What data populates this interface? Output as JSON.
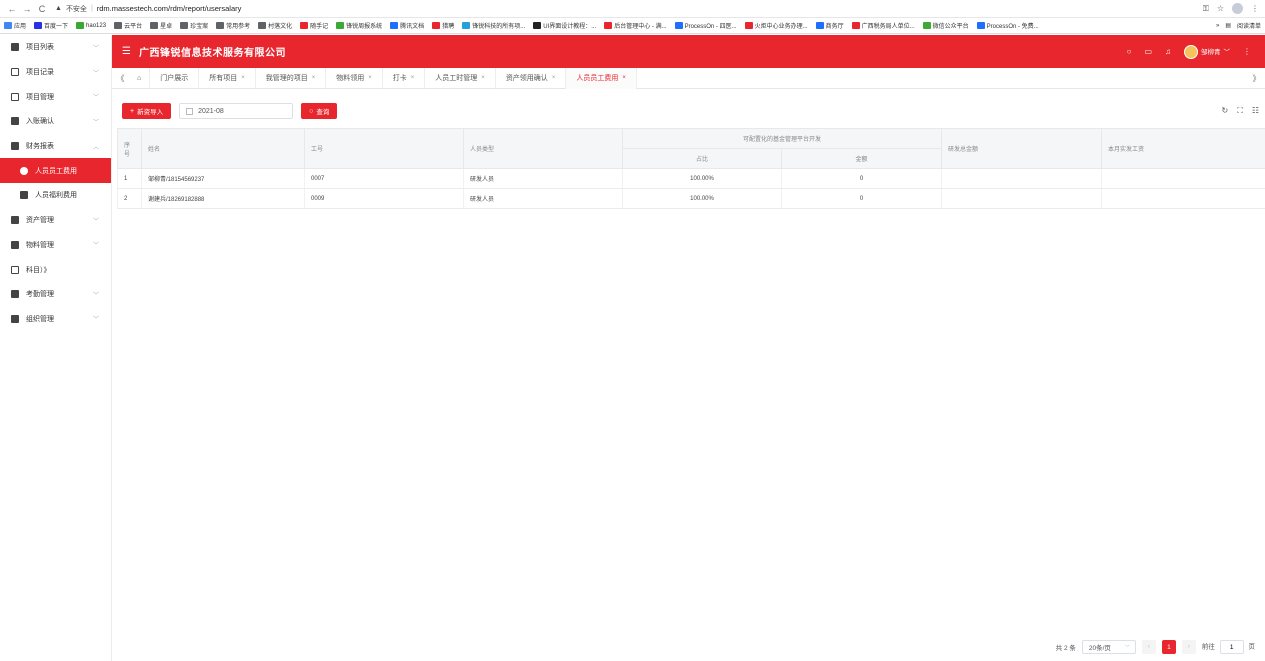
{
  "browser": {
    "insecure_label": "不安全",
    "url": "rdm.massestech.com/rdm/report/usersalary",
    "bookmarks": [
      {
        "label": "应用",
        "color": "#4285f4"
      },
      {
        "label": "百度一下",
        "color": "#2932e1"
      },
      {
        "label": "hao123",
        "color": "#38a832"
      },
      {
        "label": "云平台",
        "color": "#5f6368"
      },
      {
        "label": "星卓",
        "color": "#5f6368"
      },
      {
        "label": "珍宝案",
        "color": "#5f6368"
      },
      {
        "label": "常用参考",
        "color": "#5f6368"
      },
      {
        "label": "村落文化",
        "color": "#5f6368"
      },
      {
        "label": "随手记",
        "color": "#e8262e"
      },
      {
        "label": "锋锐周报系统",
        "color": "#3aaa35"
      },
      {
        "label": "腾讯文档",
        "color": "#1e6fff"
      },
      {
        "label": "猎聘",
        "color": "#e8262e"
      },
      {
        "label": "锋锐科技的所有项...",
        "color": "#26a0da"
      },
      {
        "label": "UI界面设计教程：...",
        "color": "#222222"
      },
      {
        "label": "后台管理中心 - 满...",
        "color": "#e8262e"
      },
      {
        "label": "ProcessOn - 四医...",
        "color": "#1e6fff"
      },
      {
        "label": "火炬中心业务办理...",
        "color": "#e8262e"
      },
      {
        "label": "商务厅",
        "color": "#1e6fff"
      },
      {
        "label": "广西税务局人单位...",
        "color": "#e8262e"
      },
      {
        "label": "微信公众平台",
        "color": "#3aaa35"
      },
      {
        "label": "ProcessOn - 免费...",
        "color": "#1e6fff"
      }
    ],
    "bookmarks_more": "»",
    "reading_list": "阅读清单"
  },
  "sidebar": {
    "items": [
      {
        "label": "项目列表",
        "chevron": "﹀",
        "icon": "folder-icon"
      },
      {
        "label": "项目记录",
        "chevron": "﹀",
        "icon": "list-icon"
      },
      {
        "label": "项目管理",
        "chevron": "﹀",
        "icon": "window-icon"
      },
      {
        "label": "入账确认",
        "chevron": "﹀",
        "icon": "user-icon"
      },
      {
        "label": "财务报表",
        "chevron": "︿",
        "icon": "report-icon"
      },
      {
        "label": "人员员工费用",
        "chevron": "",
        "icon": "person-icon",
        "active": true
      },
      {
        "label": "人员福利费用",
        "chevron": "",
        "icon": "card-icon"
      },
      {
        "label": "资产管理",
        "chevron": "﹀",
        "icon": "briefcase-icon"
      },
      {
        "label": "物料管理",
        "chevron": "﹀",
        "icon": "layers-icon"
      },
      {
        "label": "科目）》",
        "chevron": "",
        "icon": "grid-icon"
      },
      {
        "label": "考勤管理",
        "chevron": "﹀",
        "icon": "clock-icon"
      },
      {
        "label": "组织管理",
        "chevron": "﹀",
        "icon": "org-icon"
      }
    ]
  },
  "header": {
    "title": "广西锋锐信息技术服务有限公司",
    "user": "邹柳青",
    "colors": {
      "brand": "#e8262e"
    }
  },
  "tabs": [
    {
      "label": "门户展示",
      "closable": false
    },
    {
      "label": "所有项目",
      "closable": true
    },
    {
      "label": "我管理的项目",
      "closable": true
    },
    {
      "label": "物料领用",
      "closable": true
    },
    {
      "label": "打卡",
      "closable": true
    },
    {
      "label": "人员工时管理",
      "closable": true
    },
    {
      "label": "资产领用确认",
      "closable": true
    },
    {
      "label": "人员员工费用",
      "closable": true,
      "active": true
    }
  ],
  "toolbar": {
    "import_label": "新资导入",
    "date_value": "2021-08",
    "query_label": "查询"
  },
  "table": {
    "headers": {
      "index": "序号",
      "name": "姓名",
      "emp_no": "工号",
      "type": "人员类型",
      "group": "可配置化的基金管理平台开发",
      "ratio": "占比",
      "amount": "金额",
      "rd_total": "研发总金额",
      "salary": "本月实发工资"
    },
    "rows": [
      {
        "index": "1",
        "name": "邹柳青/18154569237",
        "emp_no": "0007",
        "type": "研发人员",
        "ratio": "100.00%",
        "amount": "0",
        "rd_total": "",
        "salary": ""
      },
      {
        "index": "2",
        "name": "谢建兵/18269182888",
        "emp_no": "0009",
        "type": "研发人员",
        "ratio": "100.00%",
        "amount": "0",
        "rd_total": "",
        "salary": ""
      }
    ]
  },
  "pagination": {
    "total": "共 2 条",
    "page_size": "20条/页",
    "current": "1",
    "goto_label": "前往",
    "goto_value": "1",
    "page_suffix": "页"
  }
}
